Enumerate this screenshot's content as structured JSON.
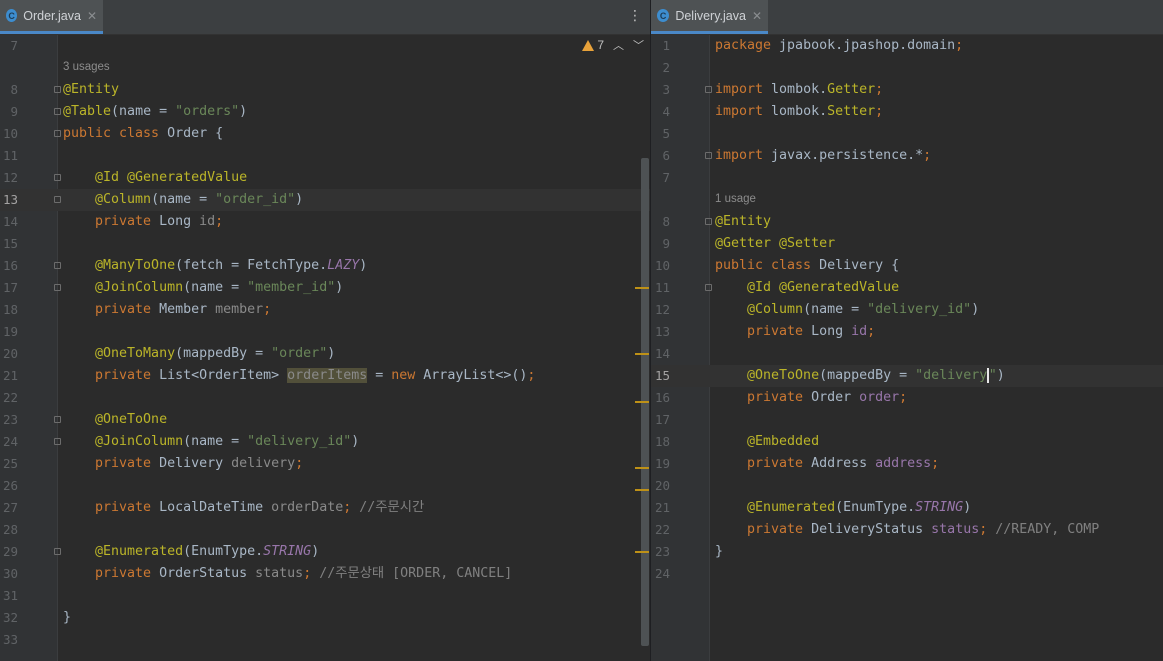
{
  "left_editor": {
    "tab": {
      "label": "Order.java",
      "icon": "class-icon",
      "icon_letter": "C"
    },
    "warnings": {
      "count": "7"
    },
    "usage_hint": "3 usages",
    "lines": [
      {
        "num": "7",
        "segments": []
      },
      {
        "num": "8",
        "segments": [
          {
            "t": "@Entity",
            "c": "an"
          }
        ]
      },
      {
        "num": "9",
        "segments": [
          {
            "t": "@Table",
            "c": "an"
          },
          {
            "t": "(name = ",
            "c": ""
          },
          {
            "t": "\"orders\"",
            "c": "str"
          },
          {
            "t": ")",
            "c": ""
          }
        ]
      },
      {
        "num": "10",
        "segments": [
          {
            "t": "public class ",
            "c": "kw"
          },
          {
            "t": "Order {",
            "c": ""
          }
        ]
      },
      {
        "num": "11",
        "segments": []
      },
      {
        "num": "12",
        "segments": [
          {
            "t": "    @Id @GeneratedValue",
            "c": "an"
          }
        ]
      },
      {
        "num": "13",
        "segments": [
          {
            "t": "    @Column",
            "c": "an"
          },
          {
            "t": "(name = ",
            "c": ""
          },
          {
            "t": "\"order_id\"",
            "c": "str"
          },
          {
            "t": ")",
            "c": ""
          }
        ]
      },
      {
        "num": "14",
        "segments": [
          {
            "t": "    private ",
            "c": "kw"
          },
          {
            "t": "Long ",
            "c": ""
          },
          {
            "t": "id",
            "c": "dim"
          },
          {
            "t": ";",
            "c": "kw"
          }
        ]
      },
      {
        "num": "15",
        "segments": []
      },
      {
        "num": "16",
        "segments": [
          {
            "t": "    @ManyToOne",
            "c": "an"
          },
          {
            "t": "(fetch = FetchType.",
            "c": ""
          },
          {
            "t": "LAZY",
            "c": "it"
          },
          {
            "t": ")",
            "c": ""
          }
        ]
      },
      {
        "num": "17",
        "segments": [
          {
            "t": "    @JoinColumn",
            "c": "an"
          },
          {
            "t": "(name = ",
            "c": ""
          },
          {
            "t": "\"member_id\"",
            "c": "str"
          },
          {
            "t": ")",
            "c": ""
          }
        ]
      },
      {
        "num": "18",
        "segments": [
          {
            "t": "    private ",
            "c": "kw"
          },
          {
            "t": "Member ",
            "c": ""
          },
          {
            "t": "member",
            "c": "dim"
          },
          {
            "t": ";",
            "c": "kw"
          }
        ]
      },
      {
        "num": "19",
        "segments": []
      },
      {
        "num": "20",
        "segments": [
          {
            "t": "    @OneToMany",
            "c": "an"
          },
          {
            "t": "(mappedBy = ",
            "c": ""
          },
          {
            "t": "\"order\"",
            "c": "str"
          },
          {
            "t": ")",
            "c": ""
          }
        ]
      },
      {
        "num": "21",
        "segments": [
          {
            "t": "    private ",
            "c": "kw"
          },
          {
            "t": "List<OrderItem> ",
            "c": ""
          },
          {
            "t": "orderItems",
            "c": "hl"
          },
          {
            "t": " = ",
            "c": ""
          },
          {
            "t": "new ",
            "c": "kw"
          },
          {
            "t": "ArrayList<>()",
            "c": ""
          },
          {
            "t": ";",
            "c": "kw"
          }
        ]
      },
      {
        "num": "22",
        "segments": []
      },
      {
        "num": "23",
        "segments": [
          {
            "t": "    @OneToOne",
            "c": "an"
          }
        ]
      },
      {
        "num": "24",
        "segments": [
          {
            "t": "    @JoinColumn",
            "c": "an"
          },
          {
            "t": "(name = ",
            "c": ""
          },
          {
            "t": "\"delivery_id\"",
            "c": "str"
          },
          {
            "t": ")",
            "c": ""
          }
        ]
      },
      {
        "num": "25",
        "segments": [
          {
            "t": "    private ",
            "c": "kw"
          },
          {
            "t": "Delivery ",
            "c": ""
          },
          {
            "t": "delivery",
            "c": "dim"
          },
          {
            "t": ";",
            "c": "kw"
          }
        ]
      },
      {
        "num": "26",
        "segments": []
      },
      {
        "num": "27",
        "segments": [
          {
            "t": "    private ",
            "c": "kw"
          },
          {
            "t": "LocalDateTime ",
            "c": ""
          },
          {
            "t": "orderDate",
            "c": "dim"
          },
          {
            "t": "; ",
            "c": "kw"
          },
          {
            "t": "//주문시간",
            "c": "cm"
          }
        ]
      },
      {
        "num": "28",
        "segments": []
      },
      {
        "num": "29",
        "segments": [
          {
            "t": "    @Enumerated",
            "c": "an"
          },
          {
            "t": "(EnumType.",
            "c": ""
          },
          {
            "t": "STRING",
            "c": "it"
          },
          {
            "t": ")",
            "c": ""
          }
        ]
      },
      {
        "num": "30",
        "segments": [
          {
            "t": "    private ",
            "c": "kw"
          },
          {
            "t": "OrderStatus ",
            "c": ""
          },
          {
            "t": "status",
            "c": "dim"
          },
          {
            "t": "; ",
            "c": "kw"
          },
          {
            "t": "//주문상태 [ORDER, CANCEL]",
            "c": "cm"
          }
        ]
      },
      {
        "num": "31",
        "segments": []
      },
      {
        "num": "32",
        "segments": [
          {
            "t": "}",
            "c": ""
          }
        ]
      },
      {
        "num": "33",
        "segments": []
      }
    ]
  },
  "right_editor": {
    "tab": {
      "label": "Delivery.java",
      "icon": "class-icon",
      "icon_letter": "C"
    },
    "usage_hint": "1 usage",
    "lines": [
      {
        "num": "1",
        "segments": [
          {
            "t": "package ",
            "c": "kw"
          },
          {
            "t": "jpabook.jpashop.domain",
            "c": ""
          },
          {
            "t": ";",
            "c": "kw"
          }
        ]
      },
      {
        "num": "2",
        "segments": []
      },
      {
        "num": "3",
        "segments": [
          {
            "t": "import ",
            "c": "kw"
          },
          {
            "t": "lombok.",
            "c": ""
          },
          {
            "t": "Getter",
            "c": "an"
          },
          {
            "t": ";",
            "c": "kw"
          }
        ]
      },
      {
        "num": "4",
        "segments": [
          {
            "t": "import ",
            "c": "kw"
          },
          {
            "t": "lombok.",
            "c": ""
          },
          {
            "t": "Setter",
            "c": "an"
          },
          {
            "t": ";",
            "c": "kw"
          }
        ]
      },
      {
        "num": "5",
        "segments": []
      },
      {
        "num": "6",
        "segments": [
          {
            "t": "import ",
            "c": "kw"
          },
          {
            "t": "javax.persistence.*",
            "c": ""
          },
          {
            "t": ";",
            "c": "kw"
          }
        ]
      },
      {
        "num": "7",
        "segments": []
      },
      {
        "num": "8",
        "segments": [
          {
            "t": "@Entity",
            "c": "an"
          }
        ]
      },
      {
        "num": "9",
        "segments": [
          {
            "t": "@Getter @Setter",
            "c": "an"
          }
        ]
      },
      {
        "num": "10",
        "segments": [
          {
            "t": "public class ",
            "c": "kw"
          },
          {
            "t": "Delivery {",
            "c": ""
          }
        ]
      },
      {
        "num": "11",
        "segments": [
          {
            "t": "    @Id @GeneratedValue",
            "c": "an"
          }
        ]
      },
      {
        "num": "12",
        "segments": [
          {
            "t": "    @Column",
            "c": "an"
          },
          {
            "t": "(name = ",
            "c": ""
          },
          {
            "t": "\"delivery_id\"",
            "c": "str"
          },
          {
            "t": ")",
            "c": ""
          }
        ]
      },
      {
        "num": "13",
        "segments": [
          {
            "t": "    private ",
            "c": "kw"
          },
          {
            "t": "Long ",
            "c": ""
          },
          {
            "t": "id",
            "c": "fld"
          },
          {
            "t": ";",
            "c": "kw"
          }
        ]
      },
      {
        "num": "14",
        "segments": []
      },
      {
        "num": "15",
        "segments": [
          {
            "t": "    @OneToOne",
            "c": "an"
          },
          {
            "t": "(mappedBy = ",
            "c": ""
          },
          {
            "t": "\"delivery",
            "c": "str"
          },
          {
            "t": "",
            "c": "caret"
          },
          {
            "t": "\"",
            "c": "str"
          },
          {
            "t": ")",
            "c": ""
          }
        ]
      },
      {
        "num": "16",
        "segments": [
          {
            "t": "    private ",
            "c": "kw"
          },
          {
            "t": "Order ",
            "c": ""
          },
          {
            "t": "order",
            "c": "fld"
          },
          {
            "t": ";",
            "c": "kw"
          }
        ]
      },
      {
        "num": "17",
        "segments": []
      },
      {
        "num": "18",
        "segments": [
          {
            "t": "    @Embedded",
            "c": "an"
          }
        ]
      },
      {
        "num": "19",
        "segments": [
          {
            "t": "    private ",
            "c": "kw"
          },
          {
            "t": "Address ",
            "c": ""
          },
          {
            "t": "address",
            "c": "fld"
          },
          {
            "t": ";",
            "c": "kw"
          }
        ]
      },
      {
        "num": "20",
        "segments": []
      },
      {
        "num": "21",
        "segments": [
          {
            "t": "    @Enumerated",
            "c": "an"
          },
          {
            "t": "(EnumType.",
            "c": ""
          },
          {
            "t": "STRING",
            "c": "it"
          },
          {
            "t": ")",
            "c": ""
          }
        ]
      },
      {
        "num": "22",
        "segments": [
          {
            "t": "    private ",
            "c": "kw"
          },
          {
            "t": "DeliveryStatus ",
            "c": ""
          },
          {
            "t": "status",
            "c": "fld"
          },
          {
            "t": "; ",
            "c": "kw"
          },
          {
            "t": "//READY, COMP",
            "c": "cm"
          }
        ]
      },
      {
        "num": "23",
        "segments": [
          {
            "t": "}",
            "c": ""
          }
        ]
      },
      {
        "num": "24",
        "segments": []
      }
    ]
  },
  "colors": {
    "background": "#2b2b2b",
    "keyword": "#cc7832",
    "annotation": "#bbb529",
    "string": "#6a8759",
    "field": "#9876aa",
    "comment": "#808080",
    "warning": "#e8a23a",
    "tab_accent": "#4a88c7"
  }
}
